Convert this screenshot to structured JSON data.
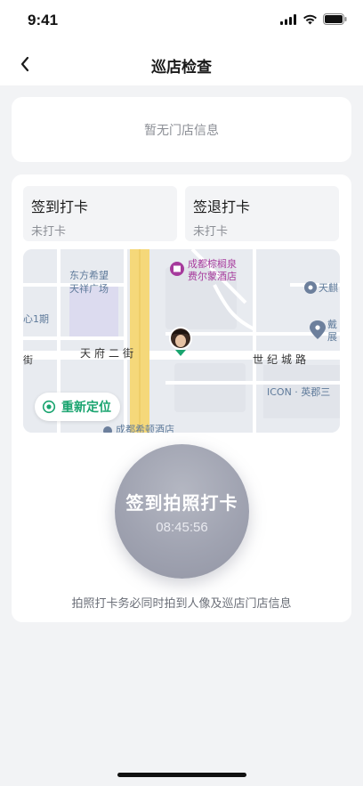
{
  "status_bar": {
    "time": "9:41"
  },
  "nav": {
    "title": "巡店检查"
  },
  "store_info": {
    "empty_text": "暂无门店信息"
  },
  "check_in_box": {
    "title": "签到打卡",
    "status": "未打卡"
  },
  "check_out_box": {
    "title": "签退打卡",
    "status": "未打卡"
  },
  "map": {
    "labels": {
      "dongfang": "东方希望",
      "tianxiang": "天祥广场",
      "hotel_line1": "成都棕榈泉",
      "hotel_line2": "费尔蒙酒店",
      "tianfu_second": "天府二街",
      "century_road": "世纪城路",
      "icon_yingdu": "ICON · 英郡三",
      "center_1": "心1期",
      "tianqi": "天麒",
      "dai": "戴",
      "zhan": "展",
      "jie": "街",
      "bottom_hotel": "成都希顿酒店"
    },
    "relocate_label": "重新定位"
  },
  "check_in_button": {
    "label": "签到拍照打卡",
    "time": "08:45:56"
  },
  "hint": "拍照打卡务必同时拍到人像及巡店门店信息",
  "colors": {
    "accent_green": "#19a46f",
    "poi_purple": "#a63a9c",
    "road_yellow": "#f5d87a"
  }
}
